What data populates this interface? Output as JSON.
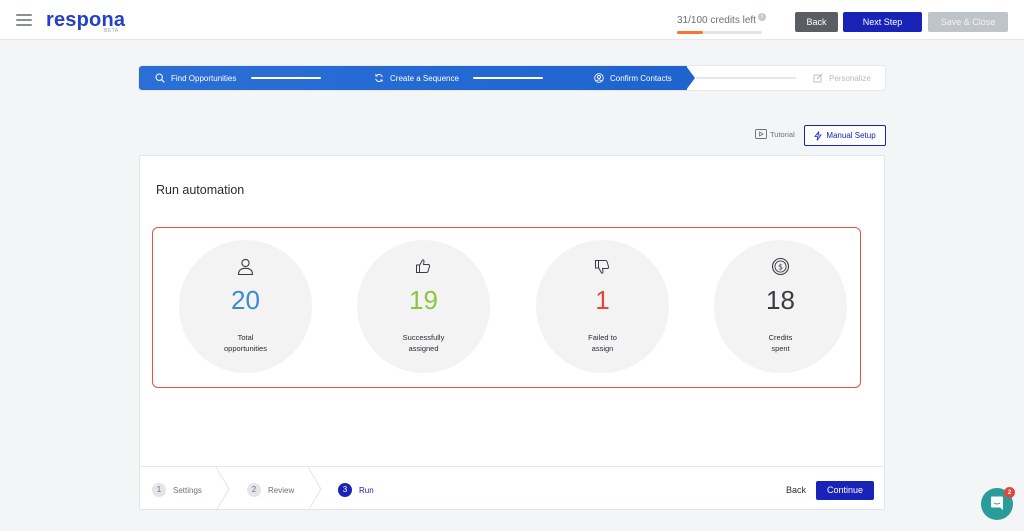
{
  "header": {
    "logo": "respona",
    "logo_badge": "BETA",
    "credits_text": "31/100 credits left",
    "credits_info": "i",
    "credits_used": 31,
    "credits_total": 100,
    "back_label": "Back",
    "next_label": "Next Step",
    "save_label": "Save & Close",
    "menu_icon": "hamburger-icon"
  },
  "progress": {
    "steps": [
      {
        "label": "Find Opportunities",
        "icon": "search-icon",
        "state": "done"
      },
      {
        "label": "Create a Sequence",
        "icon": "refresh-icon",
        "state": "done"
      },
      {
        "label": "Confirm Contacts",
        "icon": "user-icon",
        "state": "active"
      },
      {
        "label": "Personalize",
        "icon": "edit-icon",
        "state": "pending"
      }
    ]
  },
  "toolbar": {
    "tutorial_label": "Tutorial",
    "manual_setup_label": "Manual Setup"
  },
  "card": {
    "title": "Run automation",
    "stats": [
      {
        "value": "20",
        "label_line1": "Total",
        "label_line2": "opportunities",
        "icon": "user-icon",
        "color": "#3a8ad6"
      },
      {
        "value": "19",
        "label_line1": "Successfully",
        "label_line2": "assigned",
        "icon": "thumbs-up-icon",
        "color": "#8cc63f"
      },
      {
        "value": "1",
        "label_line1": "Failed to",
        "label_line2": "assign",
        "icon": "thumbs-down-icon",
        "color": "#e0483a"
      },
      {
        "value": "18",
        "label_line1": "Credits",
        "label_line2": "spent",
        "icon": "coin-icon",
        "color": "#3a3c42"
      }
    ],
    "highlight_color": "#e3543f"
  },
  "wizard": {
    "steps": [
      {
        "num": "1",
        "label": "Settings",
        "state": "done"
      },
      {
        "num": "2",
        "label": "Review",
        "state": "done"
      },
      {
        "num": "3",
        "label": "Run",
        "state": "active"
      }
    ],
    "back_label": "Back",
    "continue_label": "Continue"
  },
  "chat": {
    "badge": "2",
    "icon": "chat-icon"
  },
  "colors": {
    "primary": "#1a23b8",
    "progress_blue": "#2b6fd6",
    "credits_orange": "#f47a2b"
  }
}
